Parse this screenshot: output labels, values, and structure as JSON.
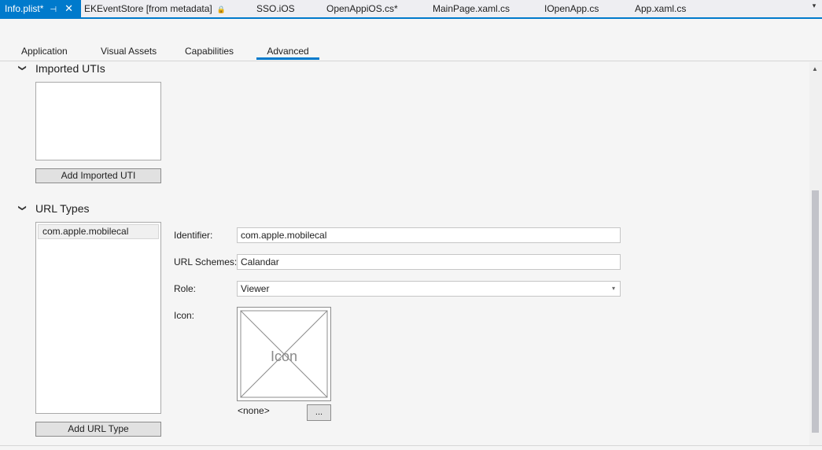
{
  "document_tabs": [
    {
      "label": "Info.plist*",
      "active": true
    },
    {
      "label": "EKEventStore [from metadata]"
    },
    {
      "label": "SSO.iOS"
    },
    {
      "label": "OpenAppiOS.cs*"
    },
    {
      "label": "MainPage.xaml.cs"
    },
    {
      "label": "IOpenApp.cs"
    },
    {
      "label": "App.xaml.cs"
    }
  ],
  "page_tabs": [
    "Application",
    "Visual Assets",
    "Capabilities",
    "Advanced"
  ],
  "active_page_tab": "Advanced",
  "imported_utis": {
    "title": "Imported UTIs",
    "add_button": "Add Imported UTI"
  },
  "url_types": {
    "title": "URL Types",
    "items": [
      "com.apple.mobilecal"
    ],
    "add_button": "Add URL Type",
    "identifier_label": "Identifier:",
    "identifier_value": "com.apple.mobilecal",
    "schemes_label": "URL Schemes:",
    "schemes_value": "Calandar",
    "role_label": "Role:",
    "role_value": "Viewer",
    "icon_label": "Icon:",
    "icon_placeholder": "Icon",
    "icon_value": "<none>",
    "browse_button": "..."
  },
  "colors": {
    "accent": "#007acc",
    "background": "#f5f5f5"
  }
}
